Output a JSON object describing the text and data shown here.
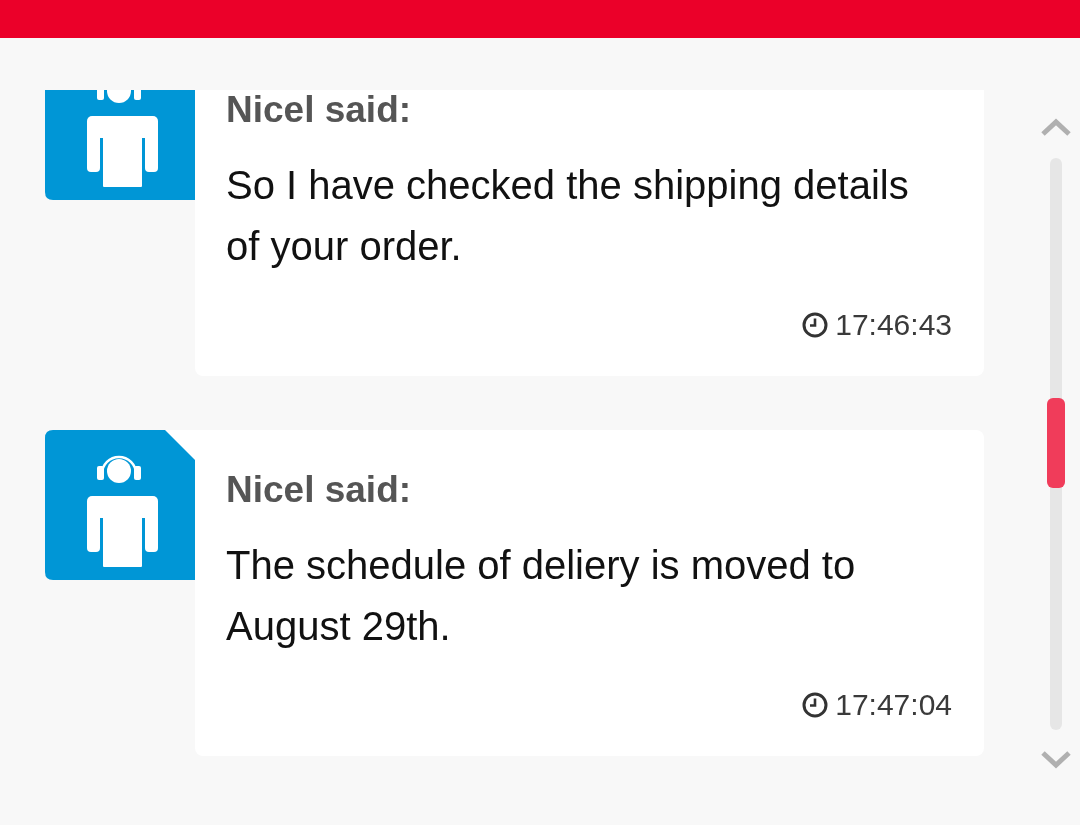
{
  "messages": [
    {
      "author_label": "Nicel said:",
      "text": "So I have checked the shipping details of your order.",
      "time": "17:46:43"
    },
    {
      "author_label": "Nicel said:",
      "text": "The schedule of deliery is moved to August 29th.",
      "time": "17:47:04"
    }
  ]
}
